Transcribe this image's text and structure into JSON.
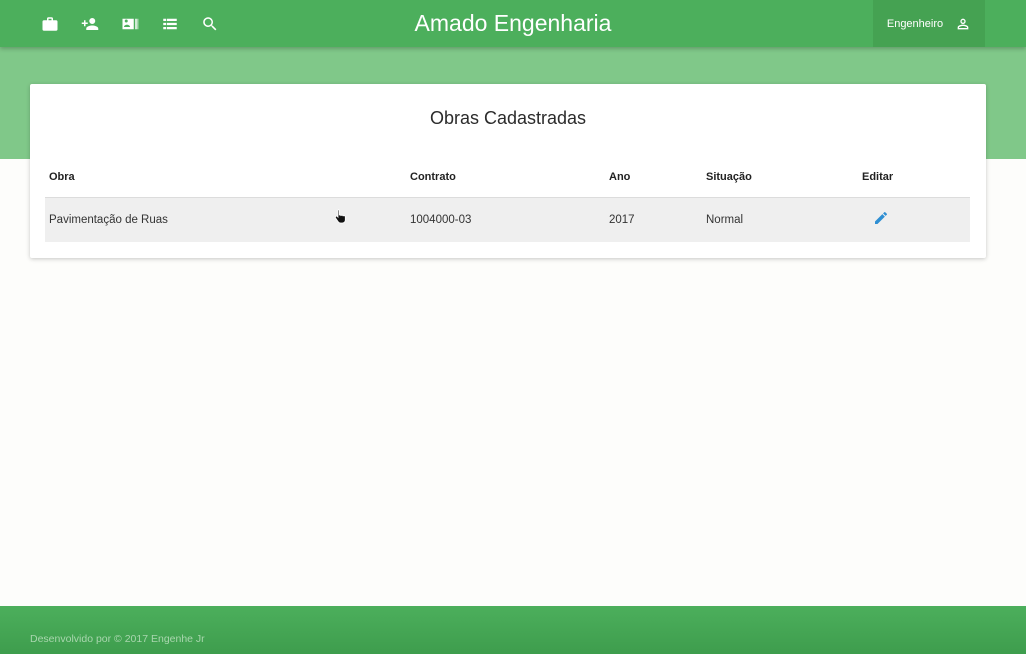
{
  "header": {
    "brand": "Amado Engenharia",
    "user_label": "Engenheiro",
    "icons": [
      "briefcase-icon",
      "person-add-icon",
      "contact-card-icon",
      "list-icon",
      "search-icon"
    ]
  },
  "main": {
    "title": "Obras Cadastradas",
    "table": {
      "headers": [
        "Obra",
        "Contrato",
        "Ano",
        "Situação",
        "Editar"
      ],
      "rows": [
        {
          "obra": "Pavimentação de Ruas",
          "contrato": "1004000-03",
          "ano": "2017",
          "situacao": "Normal"
        }
      ]
    }
  },
  "footer": {
    "text": "Desenvolvido por © 2017 Engenhe Jr"
  },
  "colors": {
    "navbar": "#4caf5c",
    "hero": "#80c889",
    "edit_icon": "#2f8fd3"
  }
}
